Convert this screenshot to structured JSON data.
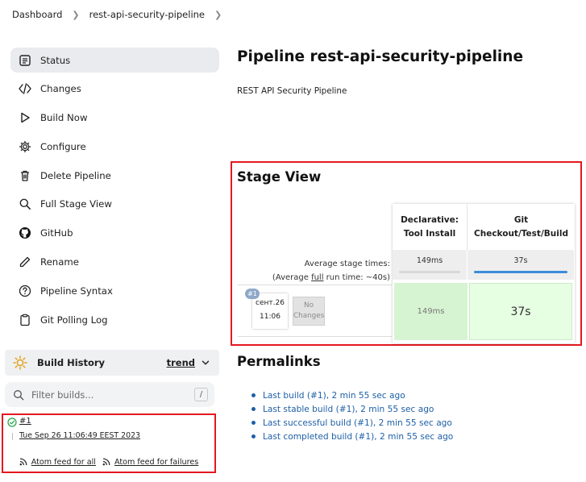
{
  "breadcrumb": {
    "items": [
      "Dashboard",
      "rest-api-security-pipeline"
    ]
  },
  "sidebar": {
    "items": [
      {
        "label": "Status",
        "icon": "status-icon",
        "active": true
      },
      {
        "label": "Changes",
        "icon": "code-icon"
      },
      {
        "label": "Build Now",
        "icon": "play-icon"
      },
      {
        "label": "Configure",
        "icon": "gear-icon"
      },
      {
        "label": "Delete Pipeline",
        "icon": "trash-icon"
      },
      {
        "label": "Full Stage View",
        "icon": "search-icon"
      },
      {
        "label": "GitHub",
        "icon": "github-icon"
      },
      {
        "label": "Rename",
        "icon": "pencil-icon"
      },
      {
        "label": "Pipeline Syntax",
        "icon": "help-icon"
      },
      {
        "label": "Git Polling Log",
        "icon": "clipboard-icon"
      }
    ]
  },
  "build_history": {
    "title": "Build History",
    "trend_label": "trend",
    "filter_placeholder": "Filter builds...",
    "filter_shortcut": "/",
    "builds": [
      {
        "number": "#1",
        "date": "Tue Sep 26 11:06:49 EEST 2023",
        "status": "success"
      }
    ],
    "feeds": {
      "all": "Atom feed for all",
      "failures": "Atom feed for failures"
    }
  },
  "main": {
    "title": "Pipeline rest-api-security-pipeline",
    "description": "REST API Security Pipeline"
  },
  "stage_view": {
    "title": "Stage View",
    "avg_stage_label": "Average stage times:",
    "avg_run_prefix": "(Average ",
    "avg_run_link": "full",
    "avg_run_suffix": " run time: ~40s)",
    "stages": [
      {
        "name_line1": "Declarative:",
        "name_line2": "Tool Install",
        "avg": "149ms",
        "avg_fraction": 0.0,
        "run": "149ms"
      },
      {
        "name_line1": "Git",
        "name_line2": "Checkout/Test/Build",
        "avg": "37s",
        "avg_fraction": 1.0,
        "run": "37s"
      }
    ],
    "run": {
      "badge": "#1",
      "date_line1": "сент.26",
      "date_line2": "11:06",
      "changes_line1": "No",
      "changes_line2": "Changes"
    }
  },
  "permalinks": {
    "title": "Permalinks",
    "links": [
      "Last build (#1), 2 min 55 sec ago",
      "Last stable build (#1), 2 min 55 sec ago",
      "Last successful build (#1), 2 min 55 sec ago",
      "Last completed build (#1), 2 min 55 sec ago"
    ]
  },
  "colors": {
    "highlight_border": "#e3191f",
    "link": "#1d5fa6",
    "stage_success_bg": "#e6ffe2",
    "progress_fill": "#3b8cd9"
  }
}
